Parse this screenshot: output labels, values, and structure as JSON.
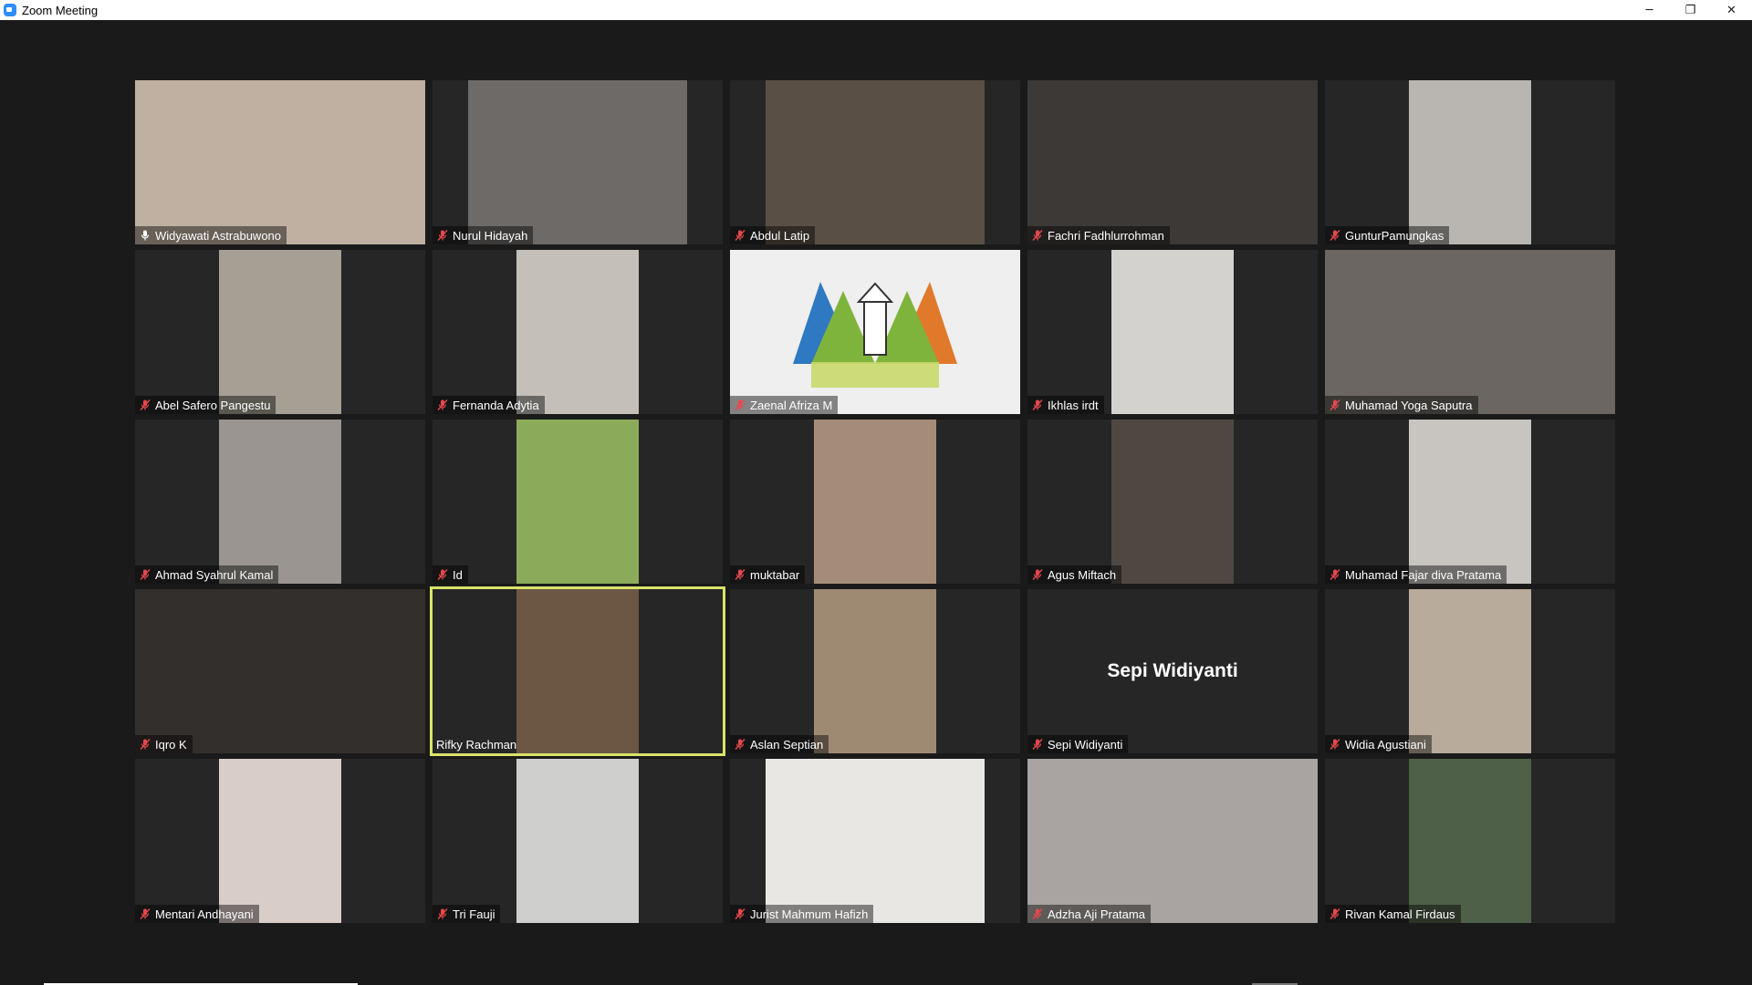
{
  "window": {
    "title": "Zoom Meeting",
    "controls": {
      "minimize": "─",
      "restore": "❐",
      "close": "✕"
    }
  },
  "colors": {
    "background": "#1a1a1a",
    "tile_background": "#262626",
    "active_speaker_border": "#d9e36a",
    "muted_icon": "#e5484d"
  },
  "participants": [
    {
      "name": "Widyawati Astrabuwono",
      "mic": "host-mic-icon",
      "video": true,
      "bg": "#bfb0a1",
      "fit": "full"
    },
    {
      "name": "Nurul Hidayah",
      "mic": "muted-mic-icon",
      "video": true,
      "bg": "#6e6a68",
      "fit": "center"
    },
    {
      "name": "Abdul Latip",
      "mic": "muted-mic-icon",
      "video": true,
      "bg": "#5a4f45",
      "fit": "center"
    },
    {
      "name": "Fachri Fadhlurrohman",
      "mic": "muted-mic-icon",
      "video": true,
      "bg": "#3c3936",
      "fit": "full"
    },
    {
      "name": "GunturPamungkas",
      "mic": "muted-mic-icon",
      "video": true,
      "bg": "#b9b5b0",
      "fit": "center"
    },
    {
      "name": "Abel Safero Pangestu",
      "mic": "muted-mic-icon",
      "video": true,
      "bg": "#a59f94",
      "fit": "center"
    },
    {
      "name": "Fernanda Adytia",
      "mic": "muted-mic-icon",
      "video": true,
      "bg": "#c4c0b9",
      "fit": "center"
    },
    {
      "name": "Zaenal Afriza M",
      "mic": "muted-mic-icon",
      "video": true,
      "bg": "#ededed",
      "fit": "full",
      "logo": "UNBAJA"
    },
    {
      "name": "Ikhlas irdt",
      "mic": "muted-mic-icon",
      "video": true,
      "bg": "#d4d2cf",
      "fit": "center"
    },
    {
      "name": "Muhamad Yoga Saputra",
      "mic": "muted-mic-icon",
      "video": true,
      "bg": "#6b6661",
      "fit": "full"
    },
    {
      "name": "Ahmad Syahrul Kamal",
      "mic": "muted-mic-icon",
      "video": true,
      "bg": "#9a9591",
      "fit": "center"
    },
    {
      "name": "Id",
      "mic": "muted-mic-icon",
      "video": true,
      "bg": "#8cab5a",
      "fit": "center"
    },
    {
      "name": "muktabar",
      "mic": "muted-mic-icon",
      "video": true,
      "bg": "#a58c78",
      "fit": "center"
    },
    {
      "name": "Agus Miftach",
      "mic": "muted-mic-icon",
      "video": true,
      "bg": "#4f4842",
      "fit": "center"
    },
    {
      "name": "Muhamad Fajar diva Pratama",
      "mic": "muted-mic-icon",
      "video": true,
      "bg": "#c8c5c1",
      "fit": "center"
    },
    {
      "name": "Iqro K",
      "mic": "muted-mic-icon",
      "video": true,
      "bg": "#332f2c",
      "fit": "full"
    },
    {
      "name": "Rifky Rachman",
      "mic": "none",
      "video": true,
      "bg": "#6c5644",
      "fit": "center",
      "active": true
    },
    {
      "name": "Aslan Septian",
      "mic": "muted-mic-icon",
      "video": true,
      "bg": "#9e8a73",
      "fit": "center"
    },
    {
      "name": "Sepi Widiyanti",
      "mic": "muted-mic-icon",
      "video": false,
      "bg": "#262626",
      "fit": "full",
      "center_label": "Sepi Widiyanti"
    },
    {
      "name": "Widia Agustiani",
      "mic": "muted-mic-icon",
      "video": true,
      "bg": "#b8ab9b",
      "fit": "center"
    },
    {
      "name": "Mentari Andhayani",
      "mic": "muted-mic-icon",
      "video": true,
      "bg": "#d9cdc8",
      "fit": "center"
    },
    {
      "name": "Tri Fauji",
      "mic": "muted-mic-icon",
      "video": true,
      "bg": "#cfcfcd",
      "fit": "center"
    },
    {
      "name": "Jurist Mahmum Hafizh",
      "mic": "muted-mic-icon",
      "video": true,
      "bg": "#e9e7e4",
      "fit": "center"
    },
    {
      "name": "Adzha Aji Pratama",
      "mic": "muted-mic-icon",
      "video": true,
      "bg": "#a9a4a1",
      "fit": "full"
    },
    {
      "name": "Rivan Kamal Firdaus",
      "mic": "muted-mic-icon",
      "video": true,
      "bg": "#4f6048",
      "fit": "center"
    }
  ]
}
